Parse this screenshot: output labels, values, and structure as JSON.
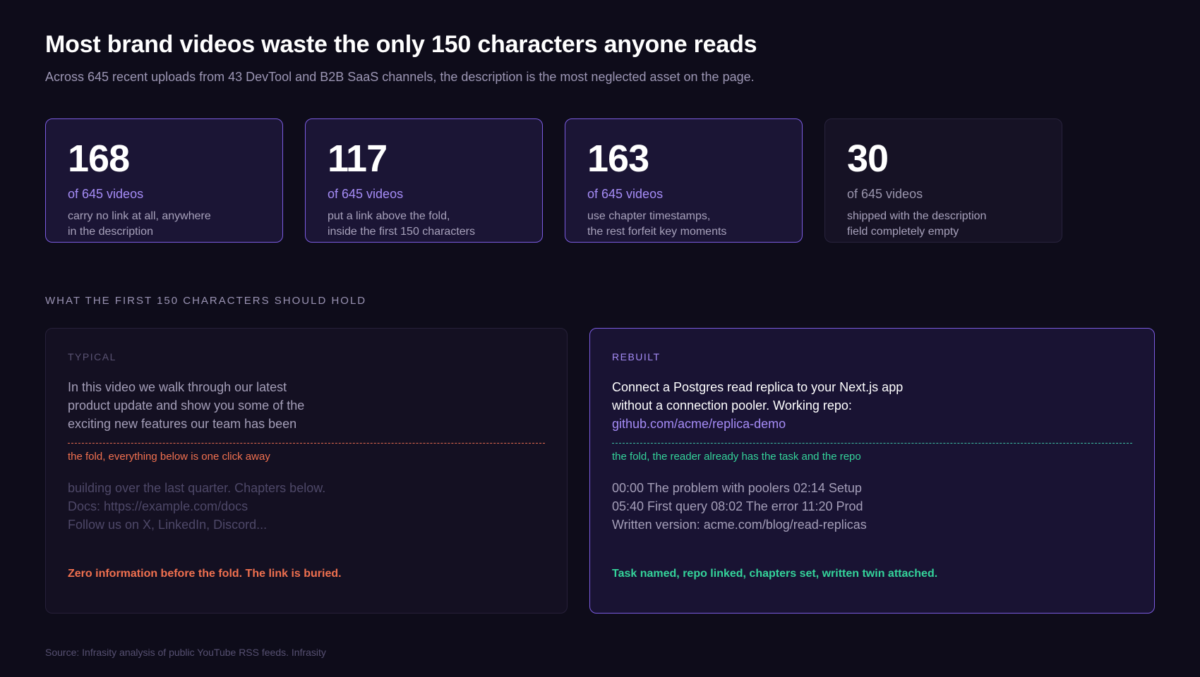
{
  "header": {
    "title": "Most brand videos waste the only 150 characters anyone reads",
    "subtitle": "Across 645 recent uploads from 43 DevTool and B2B SaaS channels, the description is the most neglected asset on the page."
  },
  "stats": [
    {
      "value": "168",
      "of": "of 645 videos",
      "desc": [
        "carry no link at all, anywhere",
        "in the description"
      ]
    },
    {
      "value": "117",
      "of": "of 645 videos",
      "desc": [
        "put a link above the fold,",
        "inside the first 150 characters"
      ]
    },
    {
      "value": "163",
      "of": "of 645 videos",
      "desc": [
        "use chapter timestamps,",
        "the rest forfeit key moments"
      ]
    },
    {
      "value": "30",
      "of": "of 645 videos",
      "desc": [
        "shipped with the description",
        "field completely empty"
      ]
    }
  ],
  "section_label": "WHAT THE FIRST 150 CHARACTERS SHOULD HOLD",
  "typical": {
    "label": "TYPICAL",
    "above": [
      "In this video we walk through our latest",
      "product update and show you some of the",
      "exciting new features our team has been"
    ],
    "fold_note": "the fold, everything below is one click away",
    "below": [
      "building over the last quarter. Chapters below.",
      "Docs: https://example.com/docs",
      "Follow us on X, LinkedIn, Discord..."
    ],
    "verdict": "Zero information before the fold. The link is buried."
  },
  "rebuilt": {
    "label": "REBUILT",
    "above": [
      "Connect a Postgres read replica to your Next.js app",
      "without a connection pooler. Working repo:"
    ],
    "link": "github.com/acme/replica-demo",
    "fold_note": "the fold, the reader already has the task and the repo",
    "below": [
      "00:00 The problem with poolers 02:14 Setup",
      "05:40 First query 08:02 The error 11:20 Prod",
      "Written version: acme.com/blog/read-replicas"
    ],
    "verdict": "Task named, repo linked, chapters set, written twin attached."
  },
  "footer": {
    "source": "Source: Infrasity analysis of public YouTube RSS feeds. Infrasity"
  },
  "colors": {
    "accent": "#7b5ce0",
    "warn": "#f0704f",
    "good": "#34d39a",
    "background": "#0e0c1a"
  }
}
